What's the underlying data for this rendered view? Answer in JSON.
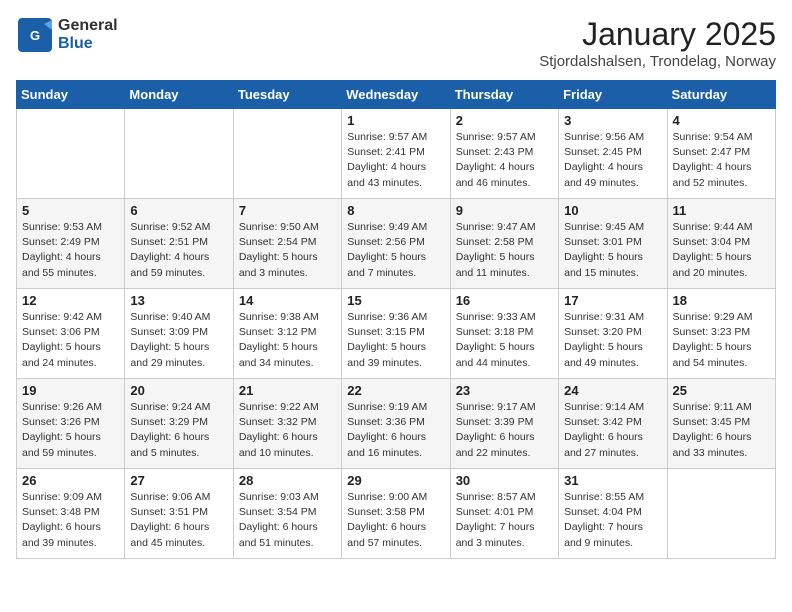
{
  "logo": {
    "general": "General",
    "blue": "Blue"
  },
  "header": {
    "month": "January 2025",
    "location": "Stjordalshalsen, Trondelag, Norway"
  },
  "weekdays": [
    "Sunday",
    "Monday",
    "Tuesday",
    "Wednesday",
    "Thursday",
    "Friday",
    "Saturday"
  ],
  "weeks": [
    [
      {
        "day": "",
        "info": ""
      },
      {
        "day": "",
        "info": ""
      },
      {
        "day": "",
        "info": ""
      },
      {
        "day": "1",
        "info": "Sunrise: 9:57 AM\nSunset: 2:41 PM\nDaylight: 4 hours and 43 minutes."
      },
      {
        "day": "2",
        "info": "Sunrise: 9:57 AM\nSunset: 2:43 PM\nDaylight: 4 hours and 46 minutes."
      },
      {
        "day": "3",
        "info": "Sunrise: 9:56 AM\nSunset: 2:45 PM\nDaylight: 4 hours and 49 minutes."
      },
      {
        "day": "4",
        "info": "Sunrise: 9:54 AM\nSunset: 2:47 PM\nDaylight: 4 hours and 52 minutes."
      }
    ],
    [
      {
        "day": "5",
        "info": "Sunrise: 9:53 AM\nSunset: 2:49 PM\nDaylight: 4 hours and 55 minutes."
      },
      {
        "day": "6",
        "info": "Sunrise: 9:52 AM\nSunset: 2:51 PM\nDaylight: 4 hours and 59 minutes."
      },
      {
        "day": "7",
        "info": "Sunrise: 9:50 AM\nSunset: 2:54 PM\nDaylight: 5 hours and 3 minutes."
      },
      {
        "day": "8",
        "info": "Sunrise: 9:49 AM\nSunset: 2:56 PM\nDaylight: 5 hours and 7 minutes."
      },
      {
        "day": "9",
        "info": "Sunrise: 9:47 AM\nSunset: 2:58 PM\nDaylight: 5 hours and 11 minutes."
      },
      {
        "day": "10",
        "info": "Sunrise: 9:45 AM\nSunset: 3:01 PM\nDaylight: 5 hours and 15 minutes."
      },
      {
        "day": "11",
        "info": "Sunrise: 9:44 AM\nSunset: 3:04 PM\nDaylight: 5 hours and 20 minutes."
      }
    ],
    [
      {
        "day": "12",
        "info": "Sunrise: 9:42 AM\nSunset: 3:06 PM\nDaylight: 5 hours and 24 minutes."
      },
      {
        "day": "13",
        "info": "Sunrise: 9:40 AM\nSunset: 3:09 PM\nDaylight: 5 hours and 29 minutes."
      },
      {
        "day": "14",
        "info": "Sunrise: 9:38 AM\nSunset: 3:12 PM\nDaylight: 5 hours and 34 minutes."
      },
      {
        "day": "15",
        "info": "Sunrise: 9:36 AM\nSunset: 3:15 PM\nDaylight: 5 hours and 39 minutes."
      },
      {
        "day": "16",
        "info": "Sunrise: 9:33 AM\nSunset: 3:18 PM\nDaylight: 5 hours and 44 minutes."
      },
      {
        "day": "17",
        "info": "Sunrise: 9:31 AM\nSunset: 3:20 PM\nDaylight: 5 hours and 49 minutes."
      },
      {
        "day": "18",
        "info": "Sunrise: 9:29 AM\nSunset: 3:23 PM\nDaylight: 5 hours and 54 minutes."
      }
    ],
    [
      {
        "day": "19",
        "info": "Sunrise: 9:26 AM\nSunset: 3:26 PM\nDaylight: 5 hours and 59 minutes."
      },
      {
        "day": "20",
        "info": "Sunrise: 9:24 AM\nSunset: 3:29 PM\nDaylight: 6 hours and 5 minutes."
      },
      {
        "day": "21",
        "info": "Sunrise: 9:22 AM\nSunset: 3:32 PM\nDaylight: 6 hours and 10 minutes."
      },
      {
        "day": "22",
        "info": "Sunrise: 9:19 AM\nSunset: 3:36 PM\nDaylight: 6 hours and 16 minutes."
      },
      {
        "day": "23",
        "info": "Sunrise: 9:17 AM\nSunset: 3:39 PM\nDaylight: 6 hours and 22 minutes."
      },
      {
        "day": "24",
        "info": "Sunrise: 9:14 AM\nSunset: 3:42 PM\nDaylight: 6 hours and 27 minutes."
      },
      {
        "day": "25",
        "info": "Sunrise: 9:11 AM\nSunset: 3:45 PM\nDaylight: 6 hours and 33 minutes."
      }
    ],
    [
      {
        "day": "26",
        "info": "Sunrise: 9:09 AM\nSunset: 3:48 PM\nDaylight: 6 hours and 39 minutes."
      },
      {
        "day": "27",
        "info": "Sunrise: 9:06 AM\nSunset: 3:51 PM\nDaylight: 6 hours and 45 minutes."
      },
      {
        "day": "28",
        "info": "Sunrise: 9:03 AM\nSunset: 3:54 PM\nDaylight: 6 hours and 51 minutes."
      },
      {
        "day": "29",
        "info": "Sunrise: 9:00 AM\nSunset: 3:58 PM\nDaylight: 6 hours and 57 minutes."
      },
      {
        "day": "30",
        "info": "Sunrise: 8:57 AM\nSunset: 4:01 PM\nDaylight: 7 hours and 3 minutes."
      },
      {
        "day": "31",
        "info": "Sunrise: 8:55 AM\nSunset: 4:04 PM\nDaylight: 7 hours and 9 minutes."
      },
      {
        "day": "",
        "info": ""
      }
    ]
  ]
}
